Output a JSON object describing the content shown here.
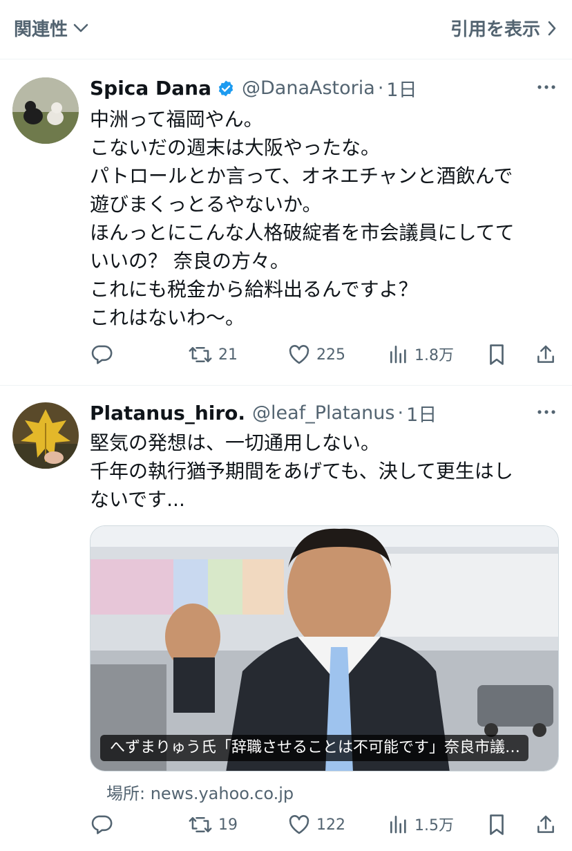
{
  "topbar": {
    "related_label": "関連性",
    "quote_label": "引用を表示"
  },
  "tweets": [
    {
      "name": "Spica Dana",
      "verified": true,
      "handle": "@DanaAstoria",
      "separator": "·",
      "time": "1日",
      "lines": [
        "中洲って福岡やん。",
        "こないだの週末は大阪やったな。",
        "パトロールとか言って、オネエチャンと酒飲んで",
        "遊びまくっとるやないか。",
        "ほんっとにこんな人格破綻者を市会議員にしてて",
        "いいの？ 奈良の方々。",
        "これにも税金から給料出るんですよ？",
        "これはないわ〜。"
      ],
      "retweets": "21",
      "likes": "225",
      "views": "1.8万"
    },
    {
      "name": "Platanus_hiro.",
      "handle": "@leaf_Platanus",
      "separator": "·",
      "time": "1日",
      "lines": [
        "堅気の発想は、一切通用しない。",
        "千年の執行猶予期間をあげても、決して更生はし",
        "ないです..."
      ],
      "card": {
        "caption": "へずまりゅう氏「辞職させることは不可能です」奈良市議…",
        "source": "場所: news.yahoo.co.jp"
      },
      "retweets": "19",
      "likes": "122",
      "views": "1.5万"
    }
  ],
  "icons": {
    "reply": "reply-icon",
    "retweet": "retweet-icon",
    "like": "heart-icon",
    "views": "views-icon",
    "bookmark": "bookmark-icon",
    "share": "share-icon"
  },
  "colors": {
    "text": "#0f1419",
    "secondary": "#536471",
    "verified": "#1d9bf0",
    "divider": "#eff3f4"
  }
}
